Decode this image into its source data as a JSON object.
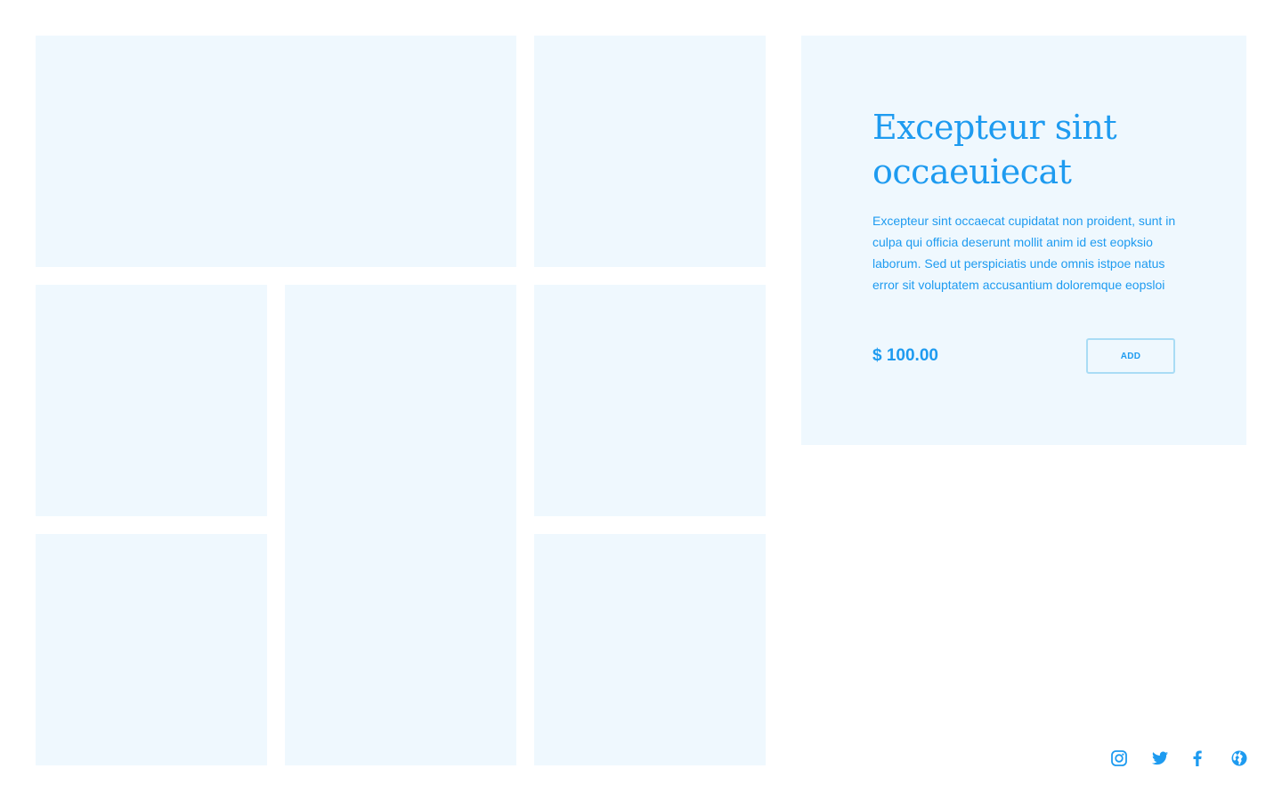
{
  "product": {
    "title": "Excepteur sint occaeuiecat",
    "description": "Excepteur sint occaecat cupidatat non proident, sunt in culpa qui officia deserunt mollit anim id est eopksio laborum. Sed ut perspiciatis unde omnis istpoe natus error sit voluptatem accusantium doloremque eopsloi",
    "price": "$ 100.00",
    "add_label": "ADD"
  },
  "gallery": {
    "tile_count": 7
  },
  "social": {
    "icons": [
      "instagram-icon",
      "twitter-icon",
      "facebook-icon",
      "globe-icon"
    ]
  },
  "colors": {
    "accent": "#1e9bf0",
    "tile_background": "#eff8fe",
    "button_border": "#a9dcf5",
    "page_background": "#ffffff"
  }
}
